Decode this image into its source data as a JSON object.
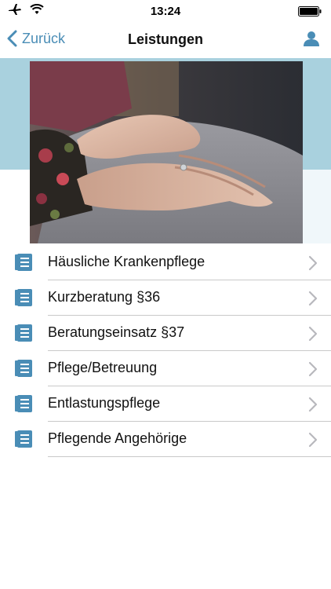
{
  "status_bar": {
    "time": "13:24",
    "icons": [
      "airplane-icon",
      "wifi-icon",
      "battery-icon"
    ]
  },
  "nav": {
    "back_label": "Zurück",
    "title": "Leistungen",
    "right_icon": "person-icon"
  },
  "colors": {
    "accent": "#4a8db6",
    "hero_band": "#a9d1de",
    "separator": "#c9c9c9"
  },
  "hero": {
    "image": "photo-hands-elderly"
  },
  "services": [
    {
      "label": "Häusliche Krankenpflege",
      "icon": "document-icon"
    },
    {
      "label": "Kurzberatung §36",
      "icon": "document-icon"
    },
    {
      "label": "Beratungseinsatz §37",
      "icon": "document-icon"
    },
    {
      "label": "Pflege/Betreuung",
      "icon": "document-icon"
    },
    {
      "label": "Entlastungspflege",
      "icon": "document-icon"
    },
    {
      "label": "Pflegende Angehörige",
      "icon": "document-icon"
    }
  ]
}
